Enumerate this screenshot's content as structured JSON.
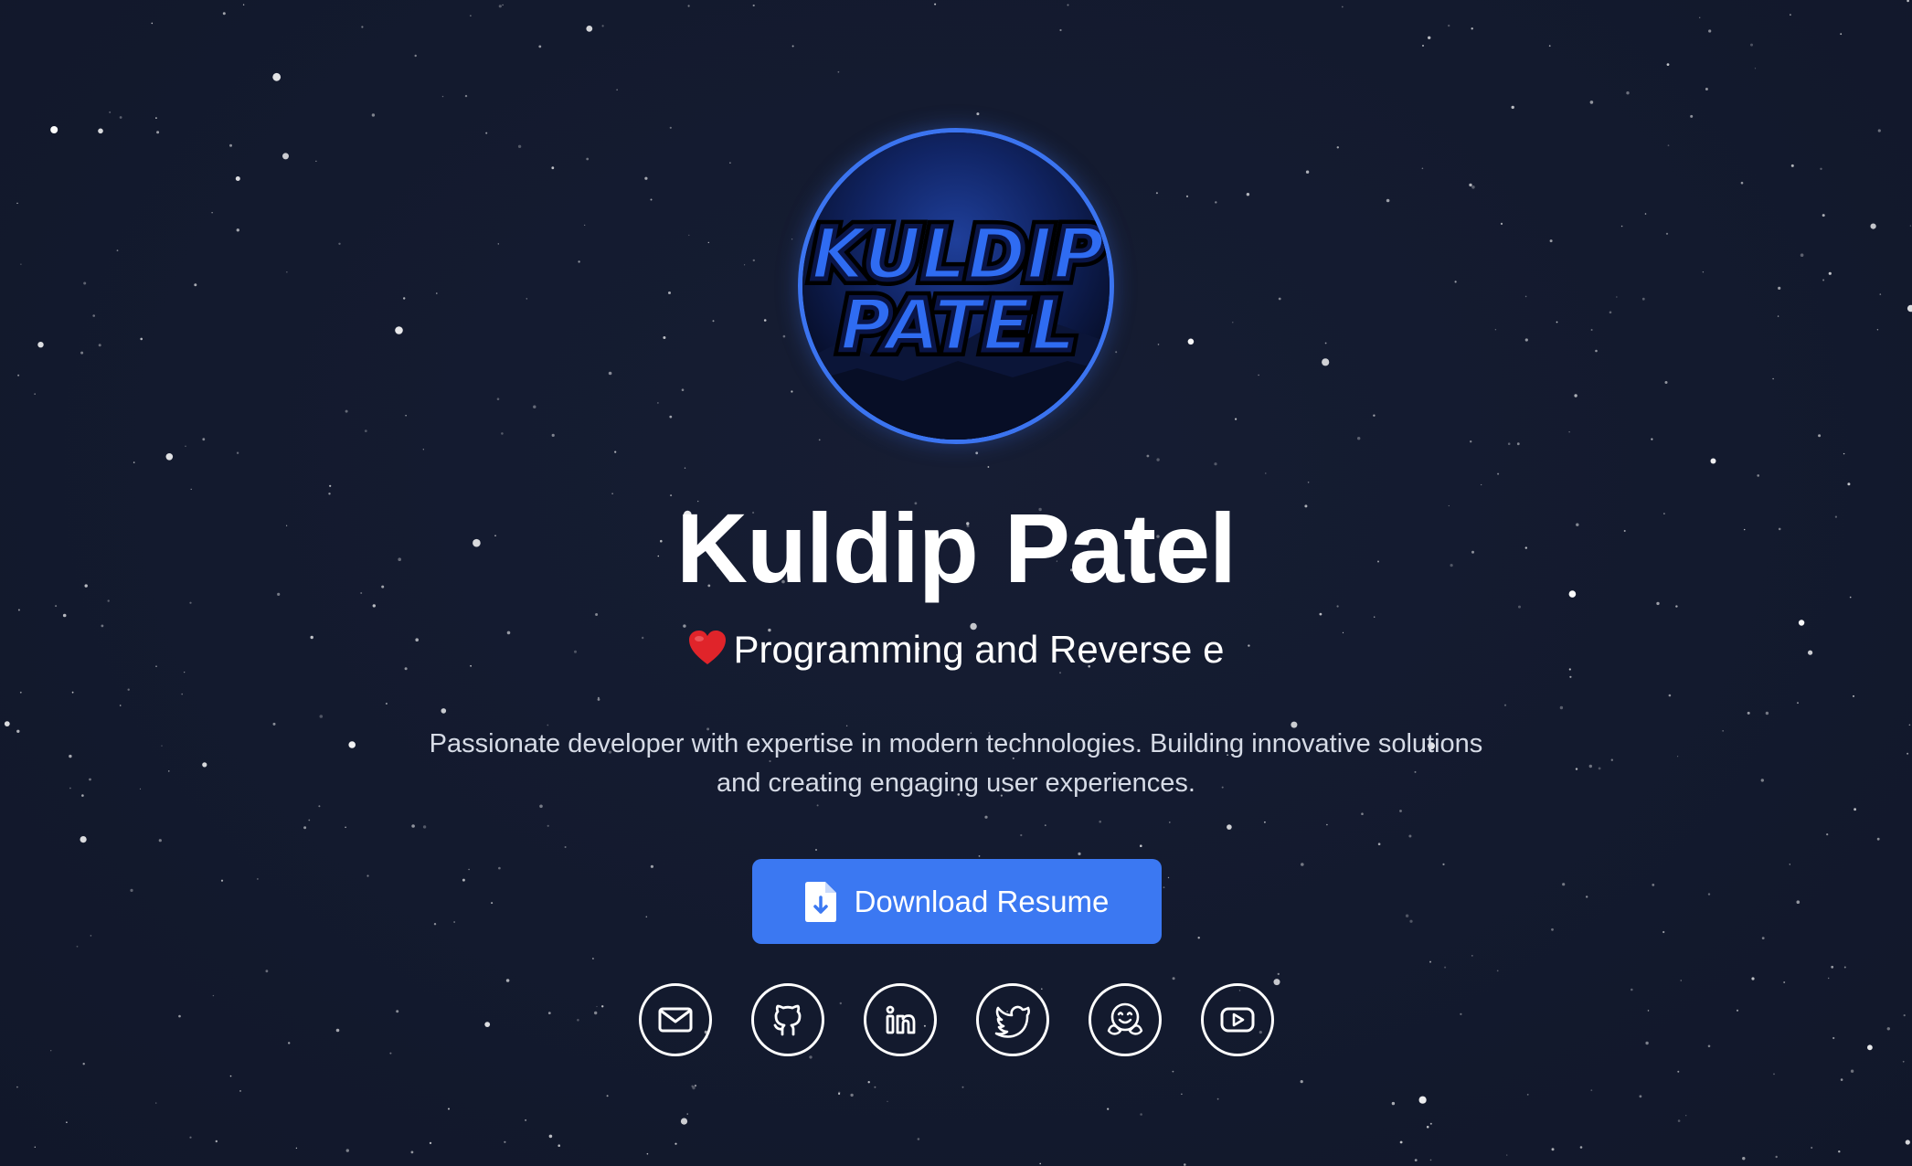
{
  "profile": {
    "avatar_text_line1": "KULDIP",
    "avatar_text_line2": "PATEL",
    "name": "Kuldip Patel",
    "tagline": "Programming and Reverse e",
    "bio": "Passionate developer with expertise in modern technologies. Building innovative solutions and creating engaging user experiences."
  },
  "actions": {
    "resume_label": "Download Resume"
  },
  "social_icons": [
    "mail-icon",
    "github-icon",
    "linkedin-icon",
    "twitter-icon",
    "huggingface-icon",
    "youtube-icon"
  ],
  "colors": {
    "background": "#131a2e",
    "accent": "#3b78f2",
    "text": "#ffffff",
    "muted_text": "#d6dbe6"
  }
}
